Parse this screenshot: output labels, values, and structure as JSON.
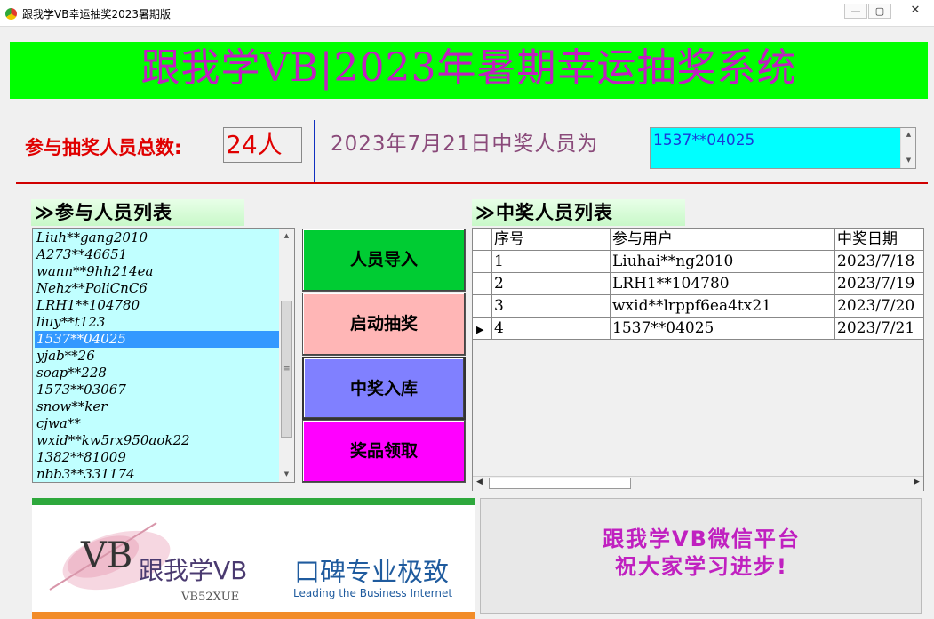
{
  "window": {
    "title": "跟我学VB幸运抽奖2023暑期版",
    "min": "—",
    "max": "▢",
    "close": "✕"
  },
  "banner": {
    "title": "跟我学VB|2023年暑期幸运抽奖系统"
  },
  "info": {
    "count_label": "参与抽奖人员总数:",
    "count_value": "24人",
    "winner_label": "2023年7月21日中奖人员为",
    "winner_value": "1537**04025"
  },
  "sections": {
    "participants": "≫参与人员列表",
    "winners": "≫中奖人员列表"
  },
  "participants": [
    "Liuh**gang2010",
    "A273**46651",
    "wann**9hh214ea",
    "Nehz**PoliCnC6",
    "LRH1**104780",
    "liuy**t123",
    "1537**04025",
    "yjab**26",
    "soap**228",
    "1573**03067",
    "snow**ker",
    "cjwa**",
    "wxid**kw5rx950aok22",
    "1382**81009",
    "nbb3**331174"
  ],
  "selected_participant_index": 6,
  "buttons": {
    "import": "人员导入",
    "draw": "启动抽奖",
    "save": "中奖入库",
    "prize": "奖品领取"
  },
  "winners_table": {
    "columns": [
      "序号",
      "参与用户",
      "中奖日期"
    ],
    "rows": [
      [
        "1",
        "Liuhai**ng2010",
        "2023/7/18"
      ],
      [
        "2",
        "LRH1**104780",
        "2023/7/19"
      ],
      [
        "3",
        "wxid**lrppf6ea4tx21",
        "2023/7/20"
      ],
      [
        "4",
        "1537**04025",
        "2023/7/21"
      ]
    ],
    "current_row_index": 3
  },
  "ad_left": {
    "logo": "VB",
    "brand": "跟我学VB",
    "sub": "VB52XUE",
    "slogan": "口碑专业极致",
    "slogan_en": "Leading the Business Internet"
  },
  "ad_right": {
    "line1": "跟我学VB微信平台",
    "line2": "祝大家学习进步!"
  },
  "colors": {
    "banner": "#00ff00",
    "title_text": "#c020c0",
    "list_bg": "#c0ffff",
    "winner_box": "#00ffff"
  }
}
